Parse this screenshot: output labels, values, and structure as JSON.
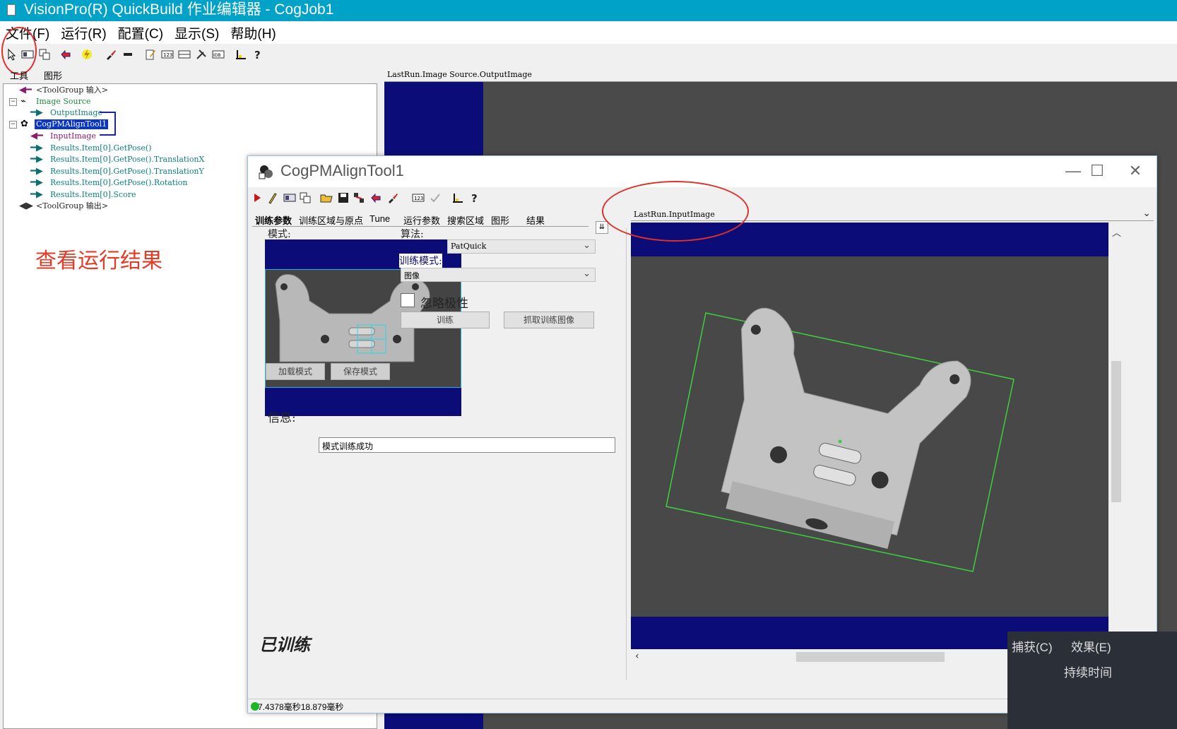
{
  "main_window": {
    "title": "VisionPro(R) QuickBuild 作业编辑器 - CogJob1",
    "menu": [
      "文件(F)",
      "运行(R)",
      "配置(C)",
      "显示(S)",
      "帮助(H)"
    ],
    "left_tabs": [
      "工具",
      "图形"
    ]
  },
  "tree": {
    "input_group": "<ToolGroup 输入>",
    "image_source": "Image Source",
    "output_image": "OutputImage",
    "pmalign_tool": "CogPMAlignTool1",
    "input_image": "InputImage",
    "results": [
      "Results.Item[0].GetPose()",
      "Results.Item[0].GetPose().TranslationX",
      "Results.Item[0].GetPose().TranslationY",
      "Results.Item[0].GetPose().Rotation",
      "Results.Item[0].Score"
    ],
    "output_group": "<ToolGroup 输出>"
  },
  "annotation": "查看运行结果",
  "main_view_header": "LastRun.Image Source.OutputImage",
  "dialog": {
    "title": "CogPMAlignTool1",
    "tabs": [
      "训练参数",
      "训练区域与原点",
      "Tune",
      "运行参数",
      "搜索区域",
      "图形",
      "结果"
    ],
    "mode_label": "模式:",
    "algorithm_label": "算法:",
    "algorithm_value": "PatQuick",
    "train_mode_label": "训练模式:",
    "train_mode_value": "图像",
    "ignore_polarity": "忽略极性",
    "train_button": "训练",
    "grab_train_image_button": "抓取训练图像",
    "load_pattern_button": "加载模式",
    "save_pattern_button": "保存模式",
    "info_label": "信息:",
    "info_value": "模式训练成功",
    "trained_status": "已训练",
    "status_text": "7.4378毫秒18.879毫秒",
    "view_header": "LastRun.InputImage"
  },
  "overlay_fragments": {
    "capture": "捕获(C)",
    "effect": "效果(E)",
    "duration": "持续时间"
  },
  "colors": {
    "titlebar": "#00a2c8",
    "annotation": "#e53a26",
    "image_background": "#0c0c78",
    "selection": "#0a36c8",
    "result_box": "#3cd03c"
  }
}
